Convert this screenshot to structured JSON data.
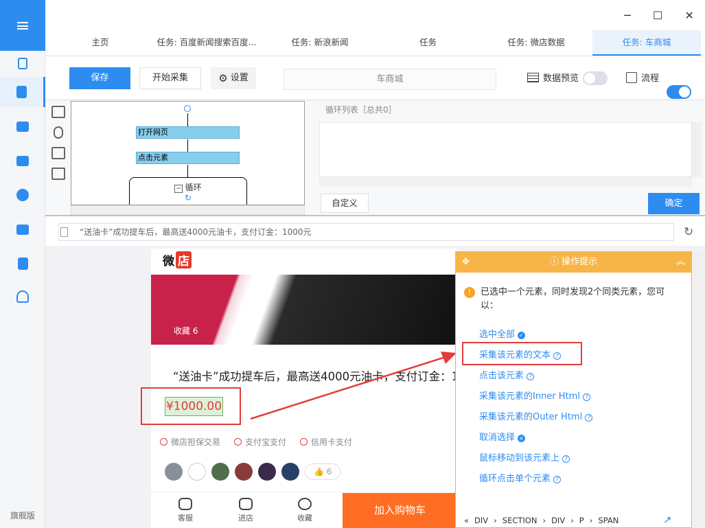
{
  "sidebar": {
    "edition": "旗舰版"
  },
  "window": {
    "minimize": "─",
    "maximize": "☐",
    "close": "✕"
  },
  "tabs": [
    {
      "label": "主页"
    },
    {
      "label": "任务: 百度新闻搜索百度..."
    },
    {
      "label": "任务: 新浪新闻"
    },
    {
      "label": "任务"
    },
    {
      "label": "任务: 微店数据"
    },
    {
      "label": "任务: 车商城",
      "active": true
    }
  ],
  "toolbar": {
    "save_label": "保存",
    "start_label": "开始采集",
    "settings_label": "设置",
    "task_name": "车商城",
    "preview_label": "数据预览",
    "preview_on": false,
    "flow_label": "流程",
    "flow_on": true
  },
  "flow": {
    "nodes": [
      "打开网页",
      "点击元素"
    ],
    "loop_label": "循环"
  },
  "loop_panel": {
    "title": "循环列表［总共0］",
    "custom_label": "自定义",
    "ok_label": "确定"
  },
  "browser": {
    "address": "“送油卡”成功提车后，最高送4000元油卡，支付订金：1000元"
  },
  "webpage": {
    "logo_text": "微",
    "logo_box": "店",
    "favorites": "收藏  6",
    "title": "“送油卡”成功提车后，最高送4000元油卡，支付订金：1000元",
    "price": "¥1000.00",
    "guarantees": [
      "微店担保交易",
      "支付宝支付",
      "信用卡支付"
    ],
    "likes": "6",
    "nav": [
      "客服",
      "进店",
      "收藏"
    ],
    "cart_label": "加入购物车"
  },
  "tips": {
    "header": "操作提示",
    "message": "已选中一个元素，同时发现2个同类元素，您可以：",
    "actions": [
      {
        "label": "选中全部"
      },
      {
        "label": "采集该元素的文本"
      },
      {
        "label": "点击该元素"
      },
      {
        "label": "采集该元素的Inner Html"
      },
      {
        "label": "采集该元素的Outer Html"
      },
      {
        "label": "取消选择"
      },
      {
        "label": "鼠标移动到该元素上"
      },
      {
        "label": "循环点击单个元素"
      }
    ],
    "breadcrumb": [
      "DIV",
      "SECTION",
      "DIV",
      "P",
      "SPAN"
    ]
  },
  "colors": {
    "accent": "#2d8cf0",
    "highlight": "#e23b3b",
    "tips": "#f8b547",
    "cart": "#ff6d22"
  }
}
